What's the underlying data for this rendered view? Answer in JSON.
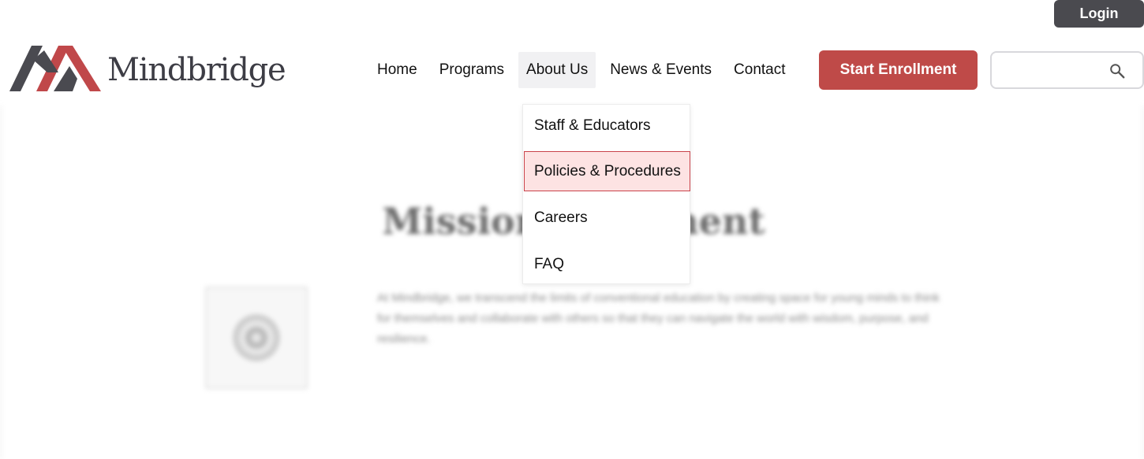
{
  "top_bar": {
    "login_label": "Login"
  },
  "header": {
    "brand": "Mindbridge",
    "nav": [
      {
        "label": "Home"
      },
      {
        "label": "Programs"
      },
      {
        "label": "About Us",
        "active": true
      },
      {
        "label": "News & Events"
      },
      {
        "label": "Contact"
      }
    ],
    "enroll_label": "Start Enrollment",
    "search": {
      "value": "",
      "placeholder": ""
    }
  },
  "dropdown": {
    "items": [
      {
        "label": "Staff & Educators"
      },
      {
        "label": "Policies & Procedures",
        "highlighted": true
      },
      {
        "label": "Careers"
      },
      {
        "label": "FAQ"
      }
    ]
  },
  "mission": {
    "title": "Mission Statement",
    "text": "At Mindbridge, we transcend the limits of conventional education by creating space for young minds to think for themselves and collaborate with others so that they can navigate the world with wisdom, purpose, and resilience."
  },
  "colors": {
    "accent": "#bf4a48",
    "login_bg": "#4a4a4f",
    "highlight_bg": "#fde3e3",
    "highlight_border": "#c9434a",
    "logo_dark": "#4a4a50",
    "logo_red": "#c0484a"
  },
  "icons": {
    "search": "search-icon",
    "logo": "logo-mark-icon",
    "mission": "target-icon"
  }
}
